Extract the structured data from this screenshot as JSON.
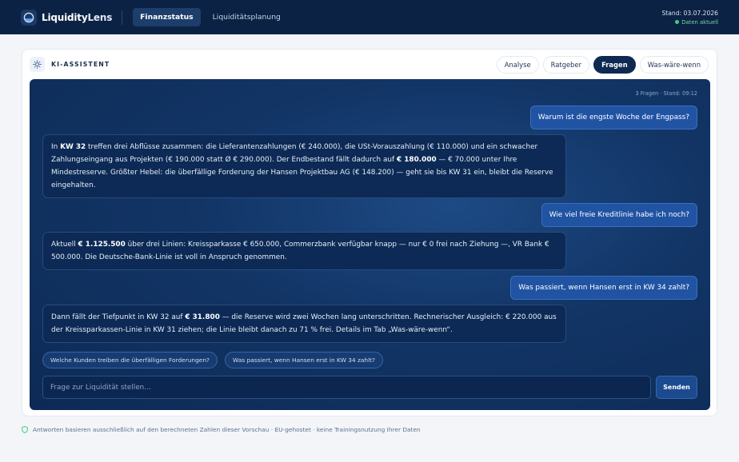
{
  "app": {
    "brand_a": "Liquidity",
    "brand_b": "Lens"
  },
  "nav": {
    "items": [
      {
        "label": "Finanzstatus",
        "active": true
      },
      {
        "label": "Liquiditätsplanung",
        "active": false
      }
    ]
  },
  "status": {
    "date": "Stand: 03.07.2026",
    "live": "Daten aktuell"
  },
  "card": {
    "title": "KI-ASSISTENT",
    "tabs": [
      {
        "label": "Analyse",
        "active": false
      },
      {
        "label": "Ratgeber",
        "active": false
      },
      {
        "label": "Fragen",
        "active": true
      },
      {
        "label": "Was-wäre-wenn",
        "active": false
      }
    ]
  },
  "chat": {
    "meta": "3 Fragen · Stand: 09:12",
    "messages": [
      {
        "role": "user",
        "segments": [
          {
            "t": "Warum ist die engste Woche der Engpass?"
          }
        ]
      },
      {
        "role": "assistant",
        "segments": [
          {
            "t": "In "
          },
          {
            "t": "KW 32",
            "b": true
          },
          {
            "t": " treffen drei Abflüsse zusammen: die Lieferantenzahlungen (€ 240.000), die USt-Vorauszahlung (€ 110.000) und ein schwacher Zahlungseingang aus Projekten (€ 190.000 statt Ø € 290.000). Der Endbestand fällt dadurch auf "
          },
          {
            "t": "€ 180.000",
            "b": true
          },
          {
            "t": " — € 70.000 unter Ihre Mindestreserve. Größter Hebel: die überfällige Forderung der Hansen Projektbau AG (€ 148.200) — geht sie bis KW 31 ein, bleibt die Reserve eingehalten."
          }
        ]
      },
      {
        "role": "user",
        "segments": [
          {
            "t": "Wie viel freie Kreditlinie habe ich noch?"
          }
        ]
      },
      {
        "role": "assistant",
        "segments": [
          {
            "t": "Aktuell "
          },
          {
            "t": "€ 1.125.500",
            "b": true
          },
          {
            "t": " über drei Linien: Kreissparkasse € 650.000, Commerzbank verfügbar knapp — nur € 0 frei nach Ziehung —, VR Bank € 500.000. Die Deutsche-Bank-Linie ist voll in Anspruch genommen."
          }
        ]
      },
      {
        "role": "user",
        "segments": [
          {
            "t": "Was passiert, wenn Hansen erst in KW 34 zahlt?"
          }
        ]
      },
      {
        "role": "assistant",
        "segments": [
          {
            "t": "Dann fällt der Tiefpunkt in KW 32 auf "
          },
          {
            "t": "€ 31.800",
            "b": true
          },
          {
            "t": " — die Reserve wird zwei Wochen lang unterschritten. Rechnerischer Ausgleich: € 220.000 aus der Kreissparkassen-Linie in KW 31 ziehen; die Linie bleibt danach zu 71 % frei. Details im Tab „Was-wäre-wenn“."
          }
        ]
      }
    ],
    "suggestions": [
      "Welche Kunden treiben die überfälligen Forderungen?",
      "Was passiert, wenn Hansen erst in KW 34 zahlt?"
    ],
    "input": {
      "placeholder": "Frage zur Liquidität stellen…",
      "value": ""
    },
    "send_label": "Senden"
  },
  "footnote": "Antworten basieren ausschließlich auf den berechneten Zahlen dieser Vorschau · EU-gehostet · keine Trainingsnutzung Ihrer Daten",
  "colors": {
    "nav_bg": "#0b2244",
    "accent": "#1d3d6b",
    "chat_bg": "#123566",
    "user_bubble": "#2054a3",
    "live_green": "#3ecf86"
  }
}
